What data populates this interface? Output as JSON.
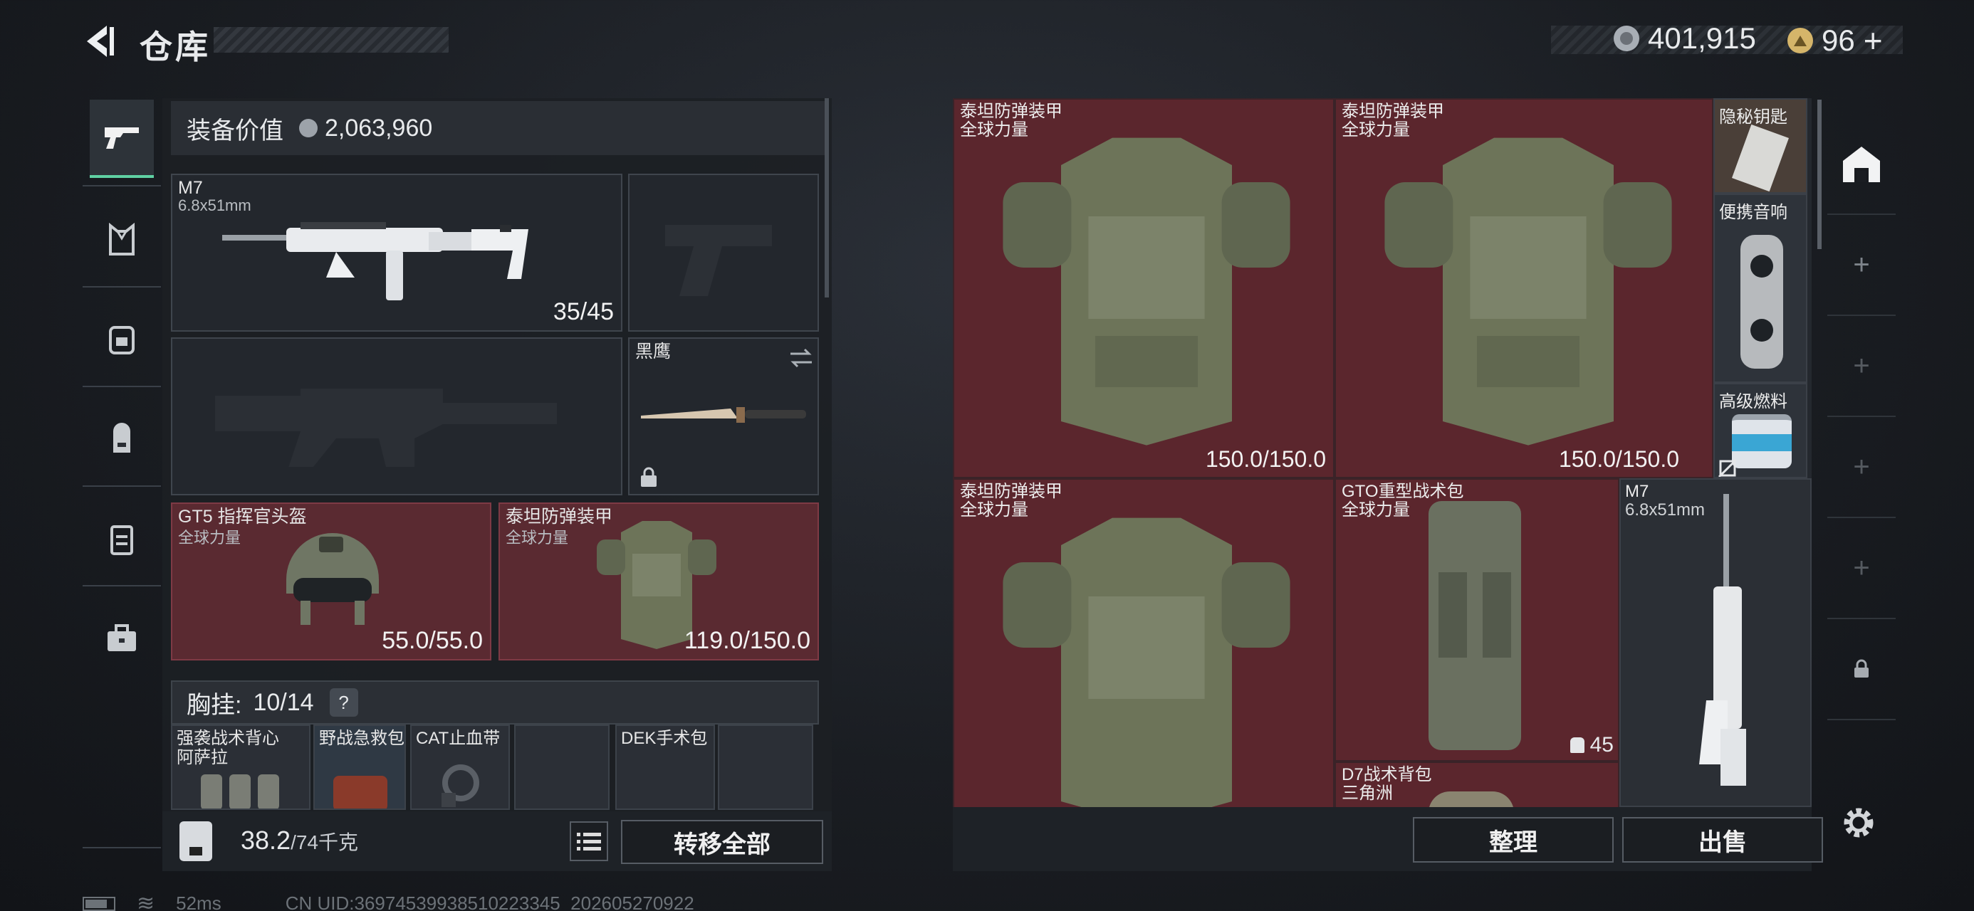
{
  "header": {
    "title": "仓库",
    "currency1": "401,915",
    "currency2": "96",
    "currency2_plus": "+"
  },
  "loadout": {
    "value_label": "装备价值",
    "value": "2,063,960",
    "primary": {
      "name": "M7",
      "caliber": "6.8x51mm",
      "ammo": "35/45"
    },
    "melee": {
      "name": "黑鹰"
    },
    "helmet": {
      "name": "GT5 指挥官头盔",
      "sub": "全球力量",
      "durability": "55.0/55.0"
    },
    "armor": {
      "name": "泰坦防弹装甲",
      "sub": "全球力量",
      "durability": "119.0/150.0"
    },
    "chest_label": "胸挂:",
    "chest_capacity": "10/14",
    "chest_help": "?",
    "chest_items": [
      {
        "name": "强袭战术背心",
        "sub": "阿萨拉"
      },
      {
        "name": "野战急救包"
      },
      {
        "name": "CAT止血带"
      },
      {
        "name": ""
      },
      {
        "name": "DEK手术包"
      },
      {
        "name": ""
      }
    ],
    "weight": "38.2",
    "weight_max": "/74千克",
    "transfer_all": "转移全部"
  },
  "stash": {
    "items": [
      {
        "name": "泰坦防弹装甲",
        "sub": "全球力量",
        "durability": "150.0/150.0"
      },
      {
        "name": "泰坦防弹装甲",
        "sub": "全球力量",
        "durability": "150.0/150.0"
      },
      {
        "name": "泰坦防弹装甲",
        "sub": "全球力量"
      },
      {
        "name": "GTO重型战术包",
        "sub": "全球力量",
        "count": "45"
      },
      {
        "name": "M7",
        "sub": "6.8x51mm"
      },
      {
        "name": "D7战术背包",
        "sub": "三角洲"
      }
    ],
    "small_items": [
      {
        "name": "隐秘钥匙"
      },
      {
        "name": "便携音响"
      },
      {
        "name": "高级燃料"
      }
    ],
    "sort_label": "整理",
    "sell_label": "出售"
  },
  "status": {
    "ping": "52ms",
    "uid": "CN UID:36974539938510223345_202605270922"
  },
  "colors": {
    "accent": "#5fd1a3",
    "rarity_red": "#5b262d"
  }
}
